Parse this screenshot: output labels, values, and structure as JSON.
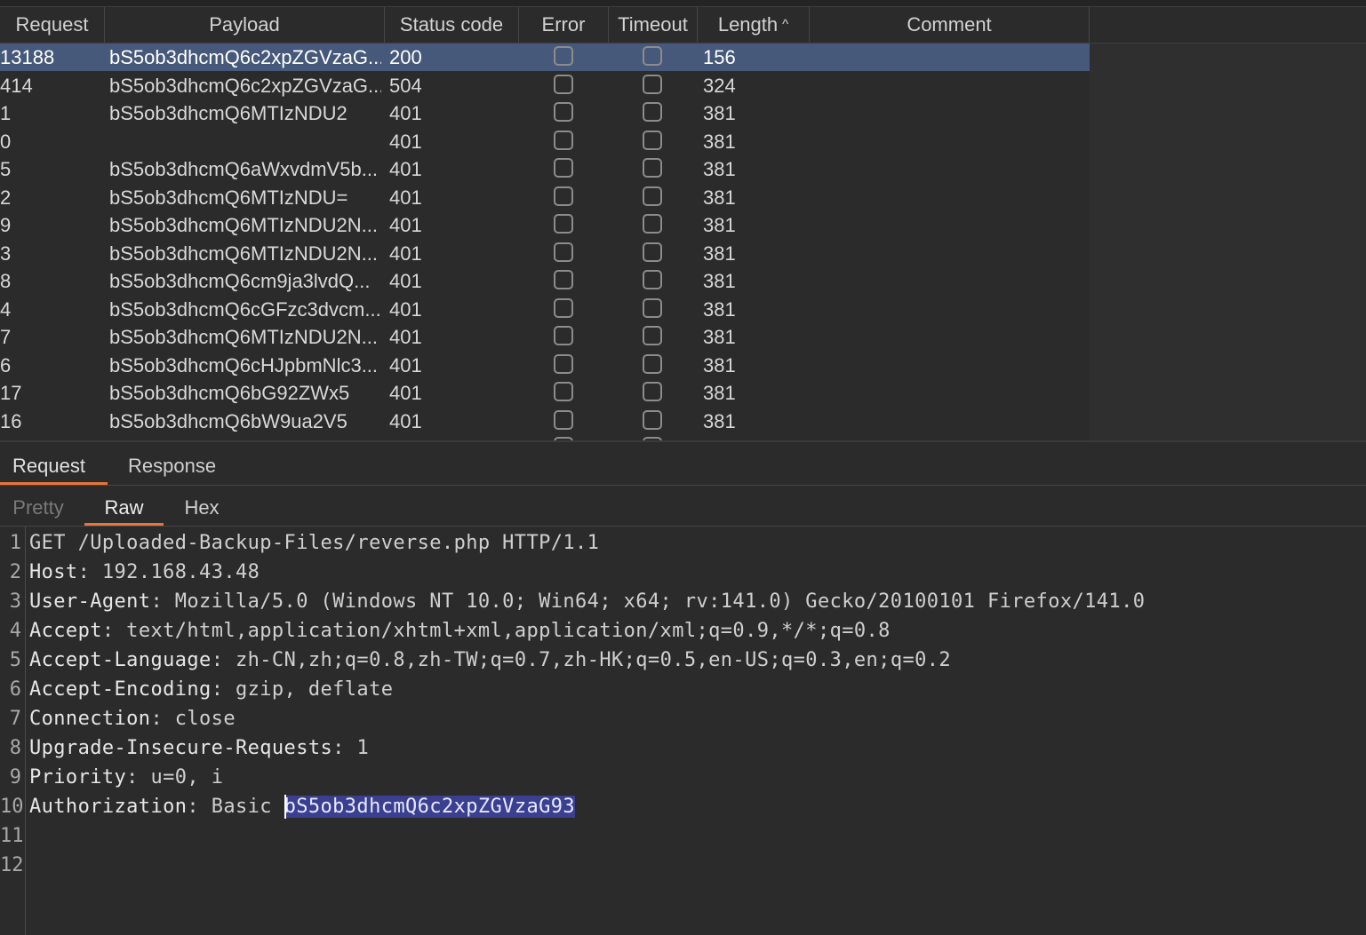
{
  "table": {
    "columns": {
      "request": "Request",
      "payload": "Payload",
      "status_code": "Status code",
      "error": "Error",
      "timeout": "Timeout",
      "length": "Length",
      "length_sort_icon": "chevron-up-icon",
      "comment": "Comment"
    },
    "rows": [
      {
        "request": "13188",
        "payload": "bS5ob3dhcmQ6c2xpZGVzaG...",
        "status": "200",
        "length": "156",
        "selected": true
      },
      {
        "request": "414",
        "payload": "bS5ob3dhcmQ6c2xpZGVzaG...",
        "status": "504",
        "length": "324"
      },
      {
        "request": "1",
        "payload": "bS5ob3dhcmQ6MTIzNDU2",
        "status": "401",
        "length": "381"
      },
      {
        "request": "0",
        "payload": "",
        "status": "401",
        "length": "381"
      },
      {
        "request": "5",
        "payload": "bS5ob3dhcmQ6aWxvdmV5b...",
        "status": "401",
        "length": "381"
      },
      {
        "request": "2",
        "payload": "bS5ob3dhcmQ6MTIzNDU=",
        "status": "401",
        "length": "381"
      },
      {
        "request": "9",
        "payload": "bS5ob3dhcmQ6MTIzNDU2N...",
        "status": "401",
        "length": "381"
      },
      {
        "request": "3",
        "payload": "bS5ob3dhcmQ6MTIzNDU2N...",
        "status": "401",
        "length": "381"
      },
      {
        "request": "8",
        "payload": "bS5ob3dhcmQ6cm9ja3lvdQ...",
        "status": "401",
        "length": "381"
      },
      {
        "request": "4",
        "payload": "bS5ob3dhcmQ6cGFzc3dvcm...",
        "status": "401",
        "length": "381"
      },
      {
        "request": "7",
        "payload": "bS5ob3dhcmQ6MTIzNDU2N...",
        "status": "401",
        "length": "381"
      },
      {
        "request": "6",
        "payload": "bS5ob3dhcmQ6cHJpbmNlc3...",
        "status": "401",
        "length": "381"
      },
      {
        "request": "17",
        "payload": "bS5ob3dhcmQ6bG92ZWx5",
        "status": "401",
        "length": "381"
      },
      {
        "request": "16",
        "payload": "bS5ob3dhcmQ6bW9ua2V5",
        "status": "401",
        "length": "381"
      }
    ]
  },
  "tabs": {
    "request": "Request",
    "response": "Response",
    "active": "Request"
  },
  "view_tabs": {
    "pretty": "Pretty",
    "raw": "Raw",
    "hex": "Hex",
    "active": "Raw"
  },
  "editor": {
    "lines": [
      {
        "n": "1",
        "text": "GET /Uploaded-Backup-Files/reverse.php HTTP/1.1"
      },
      {
        "n": "2",
        "name": "Host",
        "value": "192.168.43.48"
      },
      {
        "n": "3",
        "name": "User-Agent",
        "value": "Mozilla/5.0 (Windows NT 10.0; Win64; x64; rv:141.0) Gecko/20100101 Firefox/141.0"
      },
      {
        "n": "4",
        "name": "Accept",
        "value": "text/html,application/xhtml+xml,application/xml;q=0.9,*/*;q=0.8"
      },
      {
        "n": "5",
        "name": "Accept-Language",
        "value": "zh-CN,zh;q=0.8,zh-TW;q=0.7,zh-HK;q=0.5,en-US;q=0.3,en;q=0.2"
      },
      {
        "n": "6",
        "name": "Accept-Encoding",
        "value": "gzip, deflate"
      },
      {
        "n": "7",
        "name": "Connection",
        "value": "close"
      },
      {
        "n": "8",
        "name": "Upgrade-Insecure-Requests",
        "value": "1"
      },
      {
        "n": "9",
        "name": "Priority",
        "value": "u=0, i"
      },
      {
        "n": "10",
        "name": "Authorization",
        "value_prefix": "Basic ",
        "value_selected": "bS5ob3dhcmQ6c2xpZGVzaG93"
      },
      {
        "n": "11",
        "text": ""
      },
      {
        "n": "12",
        "text": ""
      }
    ]
  },
  "colors": {
    "accent": "#e8743a",
    "selected_row": "#46597a",
    "text_selection": "#3b3f8f",
    "background": "#2b2b2b"
  }
}
